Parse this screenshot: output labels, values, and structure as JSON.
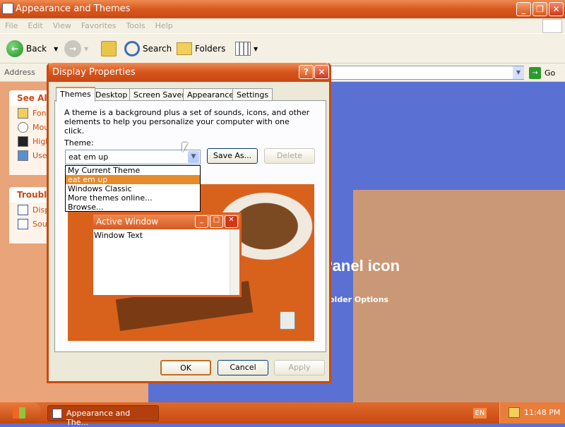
{
  "window": {
    "title": "Appearance and Themes"
  },
  "menu": [
    "File",
    "Edit",
    "View",
    "Favorites",
    "Tools",
    "Help"
  ],
  "toolbar": {
    "back": "Back",
    "search": "Search",
    "folders": "Folders"
  },
  "address": {
    "label": "Address",
    "go": "Go"
  },
  "sidepanel": {
    "see_also": {
      "title": "See Als",
      "items": [
        "Fon",
        "Mou",
        "High",
        "Use"
      ]
    },
    "troubleshooters": {
      "title": "Trouble",
      "items": [
        "Disp",
        "Sou"
      ]
    }
  },
  "content": {
    "heading": "Panel icon",
    "link": "older Options"
  },
  "dialog": {
    "title": "Display Properties",
    "tabs": [
      "Themes",
      "Desktop",
      "Screen Saver",
      "Appearance",
      "Settings"
    ],
    "description": "A theme is a background plus a set of sounds, icons, and other elements to help you personalize your computer with one click.",
    "theme_label": "Theme:",
    "theme_value": "eat em up",
    "theme_options": [
      "My Current Theme",
      "eat em up",
      "Windows Classic",
      "More themes online...",
      "Browse..."
    ],
    "save_as": "Save As...",
    "delete": "Delete",
    "preview": {
      "window_title": "Active Window",
      "window_text": "Window Text"
    },
    "ok": "OK",
    "cancel": "Cancel",
    "apply": "Apply"
  },
  "taskbar": {
    "task": "Appearance and The...",
    "lang": "EN",
    "time": "11:48 PM"
  },
  "colors": {
    "accent": "#d9581f",
    "selection": "#e68b2c",
    "content_bg": "#5a71d3",
    "sidepanel": "#e9a47a"
  }
}
